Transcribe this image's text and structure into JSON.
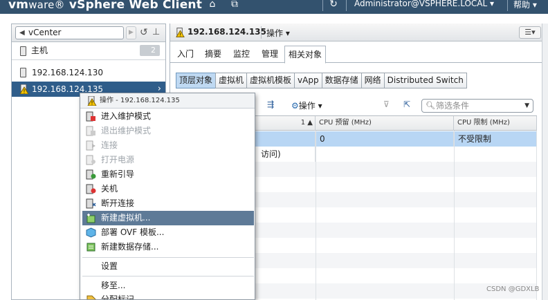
{
  "header": {
    "brand_prefix": "vm",
    "brand_suffix": "ware®",
    "product": " vSphere Web Client",
    "user": "Administrator@VSPHERE.LOCAL ▾",
    "help": "帮助 ▾"
  },
  "nav": {
    "back_label": "vCenter",
    "host_group_label": "主机",
    "host_count": "2",
    "hosts": [
      {
        "label": "192.168.124.130",
        "status": "normal"
      },
      {
        "label": "192.168.124.135",
        "status": "warning",
        "selected": true
      }
    ]
  },
  "object": {
    "title": "192.168.124.135",
    "actions_label": "操作 ▾"
  },
  "tabs": [
    "入门",
    "摘要",
    "监控",
    "管理",
    "相关对象"
  ],
  "active_tab": "相关对象",
  "subtabs": [
    "顶层对象",
    "虚拟机",
    "虚拟机模板",
    "vApp",
    "数据存储",
    "网络",
    "Distributed Switch"
  ],
  "active_subtab": "顶层对象",
  "toolbar": {
    "actions_label": "操作 ▾",
    "filter_placeholder": "筛选条件"
  },
  "grid": {
    "sort_indicator": "1 ▲",
    "columns": [
      "CPU 预留 (MHz)",
      "CPU 限制 (MHz)"
    ],
    "rows": [
      {
        "partial_name": "",
        "cpu_reservation": "0",
        "cpu_limit": "不受限制"
      },
      {
        "partial_name": "访问)",
        "cpu_reservation": "",
        "cpu_limit": ""
      }
    ]
  },
  "context_menu": {
    "header": "操作 - 192.168.124.135",
    "items": [
      {
        "label": "进入维护模式",
        "enabled": true,
        "icon": "maintenance-enter-icon"
      },
      {
        "label": "退出维护模式",
        "enabled": false,
        "icon": "maintenance-exit-icon"
      },
      {
        "label": "连接",
        "enabled": false,
        "icon": "connect-icon"
      },
      {
        "label": "打开电源",
        "enabled": false,
        "icon": "power-on-icon"
      },
      {
        "label": "重新引导",
        "enabled": true,
        "icon": "reboot-icon"
      },
      {
        "label": "关机",
        "enabled": true,
        "icon": "shutdown-icon"
      },
      {
        "label": "断开连接",
        "enabled": true,
        "icon": "disconnect-icon"
      },
      {
        "label": "新建虚拟机...",
        "enabled": true,
        "highlighted": true,
        "icon": "new-vm-icon"
      },
      {
        "label": "部署 OVF 模板...",
        "enabled": true,
        "icon": "ovf-icon"
      },
      {
        "label": "新建数据存储...",
        "enabled": true,
        "icon": "datastore-icon"
      },
      {
        "label": "设置",
        "enabled": true,
        "icon": ""
      },
      {
        "label": "移至...",
        "enabled": true,
        "icon": ""
      },
      {
        "label": "分配标记...",
        "enabled": true,
        "icon": "tag-icon"
      }
    ]
  },
  "watermark": "CSDN @GDXLB",
  "colors": {
    "header_bg": "#33526e",
    "selection": "#2f5d8a",
    "grid_selection": "#b8d6f4",
    "menu_highlight": "#5e7a97"
  }
}
